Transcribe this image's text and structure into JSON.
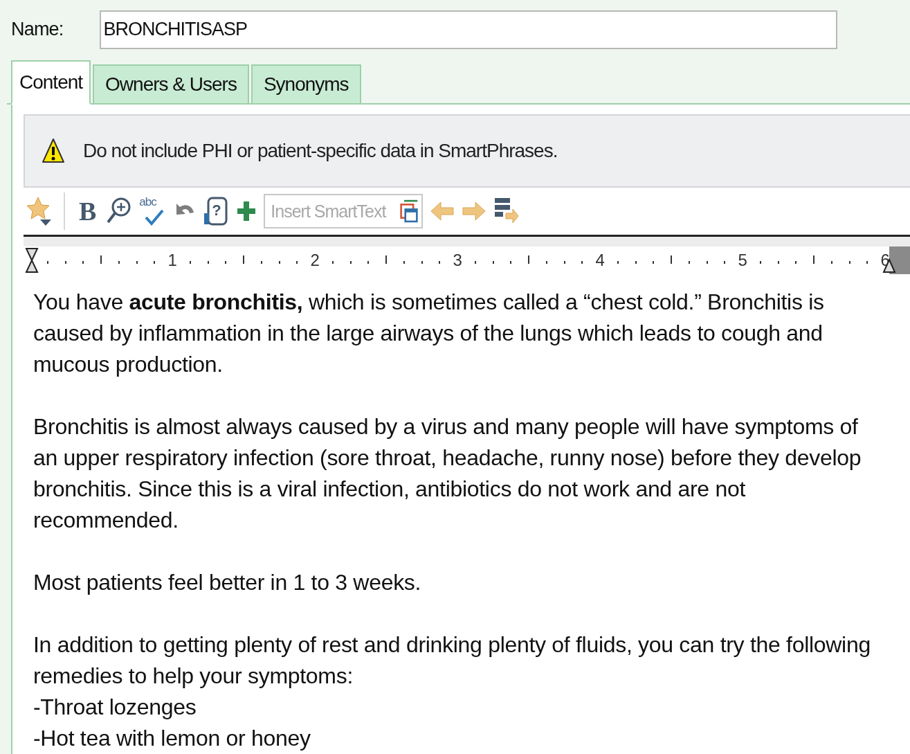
{
  "name_field": {
    "label": "Name:",
    "value": "BRONCHITISASP"
  },
  "tabs": [
    {
      "label": "Content",
      "selected": true
    },
    {
      "label": "Owners & Users",
      "selected": false
    },
    {
      "label": "Synonyms",
      "selected": false
    }
  ],
  "warning": {
    "text": "Do not include PHI or patient-specific data in SmartPhrases."
  },
  "toolbar": {
    "bold_label": "B",
    "spell_label": "abc",
    "help_label": "?",
    "insert_placeholder": "Insert SmartText"
  },
  "ruler": {
    "numbers": [
      "1",
      "2",
      "3",
      "4",
      "5",
      "6"
    ]
  },
  "document": {
    "lines": [
      {
        "kind": "paragraph",
        "text": "You have **acute bronchitis,** which is sometimes called a “chest cold.”  Bronchitis is caused by inflammation in the large airways of the lungs which leads to cough and mucous production."
      },
      {
        "kind": "blank"
      },
      {
        "kind": "paragraph",
        "text": "Bronchitis is almost always caused by a virus and many people will have symptoms of an upper respiratory infection (sore throat, headache, runny nose) before they develop bronchitis. Since this is a viral infection, antibiotics do not work and are not recommended."
      },
      {
        "kind": "blank"
      },
      {
        "kind": "paragraph",
        "text": "Most patients feel better in 1 to 3 weeks."
      },
      {
        "kind": "blank"
      },
      {
        "kind": "paragraph",
        "text": "In addition to getting plenty of rest and drinking plenty of fluids, you can try the following remedies to help your symptoms:"
      },
      {
        "kind": "paragraph",
        "text": "-Throat lozenges"
      },
      {
        "kind": "paragraph",
        "text": "-Hot tea with lemon or honey"
      }
    ]
  }
}
